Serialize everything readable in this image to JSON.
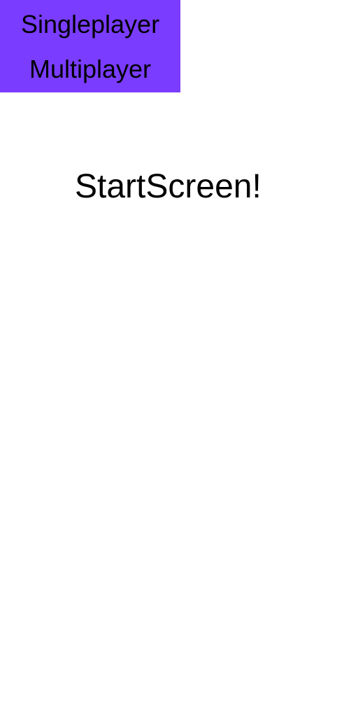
{
  "colors": {
    "menu_background": "#7a3cff",
    "page_background": "#ffffff",
    "text": "#000000"
  },
  "menu": {
    "singleplayer_label": "Singleplayer",
    "multiplayer_label": "Multiplayer"
  },
  "screen": {
    "title": "StartScreen!"
  }
}
